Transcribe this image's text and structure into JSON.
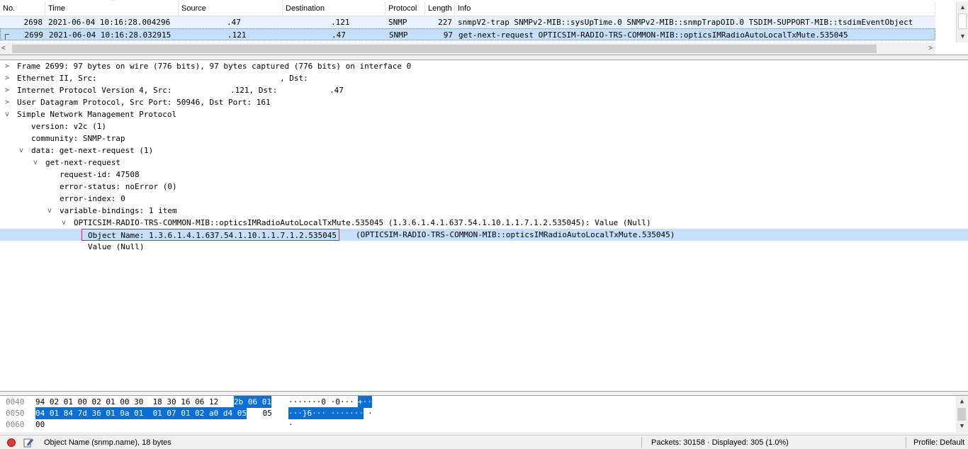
{
  "packet_list": {
    "columns": [
      "No.",
      "Time",
      "Source",
      "Destination",
      "Protocol",
      "Length",
      "Info"
    ],
    "rows": [
      {
        "no": "2698",
        "time": "2021-06-04 10:16:28.004296",
        "source": ".47",
        "destination": ".121",
        "protocol": "SNMP",
        "length": "227",
        "info": "snmpV2-trap SNMPv2-MIB::sysUpTime.0 SNMPv2-MIB::snmpTrapOID.0 TSDIM-SUPPORT-MIB::tsdimEventObject"
      },
      {
        "no": "2699",
        "time": "2021-06-04 10:16:28.032915",
        "source": ".121",
        "destination": ".47",
        "protocol": "SNMP",
        "length": "97",
        "info": "get-next-request OPTICSIM-RADIO-TRS-COMMON-MIB::opticsIMRadioAutoLocalTxMute.535045"
      }
    ]
  },
  "details": {
    "frame": "Frame 2699: 97 bytes on wire (776 bits), 97 bytes captured (776 bits) on interface 0",
    "ethernet_a": "Ethernet II, Src:",
    "ethernet_b": ", Dst:",
    "ip_a": "Internet Protocol Version 4, Src:",
    "ip_b": ".121, Dst:",
    "ip_c": ".47",
    "udp": "User Datagram Protocol, Src Port: 50946, Dst Port: 161",
    "snmp": "Simple Network Management Protocol",
    "version": "version: v2c (1)",
    "community": "community: SNMP-trap",
    "data": "data: get-next-request (1)",
    "gnr": "get-next-request",
    "request_id": "request-id: 47508",
    "error_status": "error-status: noError (0)",
    "error_index": "error-index: 0",
    "varbinds": "variable-bindings: 1 item",
    "varbind": "OPTICSIM-RADIO-TRS-COMMON-MIB::opticsIMRadioAutoLocalTxMute.535045 (1.3.6.1.4.1.637.54.1.10.1.1.7.1.2.535045): Value (Null)",
    "object_name": "Object Name: 1.3.6.1.4.1.637.54.1.10.1.1.7.1.2.535045",
    "object_name_rest": "(OPTICSIM-RADIO-TRS-COMMON-MIB::opticsIMRadioAutoLocalTxMute.535045)",
    "value": "Value (Null)"
  },
  "bytes": [
    {
      "offset": "0040",
      "hex_a": "94 02 01 00 02 01 00 30  18 30 16 06 12 ",
      "hex_b": "2b 06 01",
      "ascii_a": "·······0 ·0···",
      "ascii_b": "+··"
    },
    {
      "offset": "0050",
      "hex_a": "",
      "hex_b": "04 01 84 7d 36 01 0a 01  01 07 01 02 a0 d4 05",
      "hex_c": " 05",
      "ascii_a": "",
      "ascii_b": "···}6··· ·······",
      "ascii_c": "·"
    },
    {
      "offset": "0060",
      "hex_a": "00",
      "ascii_a": "·"
    }
  ],
  "status": {
    "field": "Object Name (snmp.name), 18 bytes",
    "packets": "Packets: 30158 · Displayed: 305 (1.0%)",
    "profile": "Profile: Default"
  },
  "icons": {
    "expert": "expert-info-icon",
    "edit": "edit-comment-icon",
    "collapsed": "chevron-right-icon",
    "expanded": "chevron-down-icon"
  },
  "colors": {
    "selected_row": "#c6dff8",
    "related_row": "#e7f0fb",
    "byte_highlight": "#0a6fd6",
    "field_outline": "#e22222"
  }
}
